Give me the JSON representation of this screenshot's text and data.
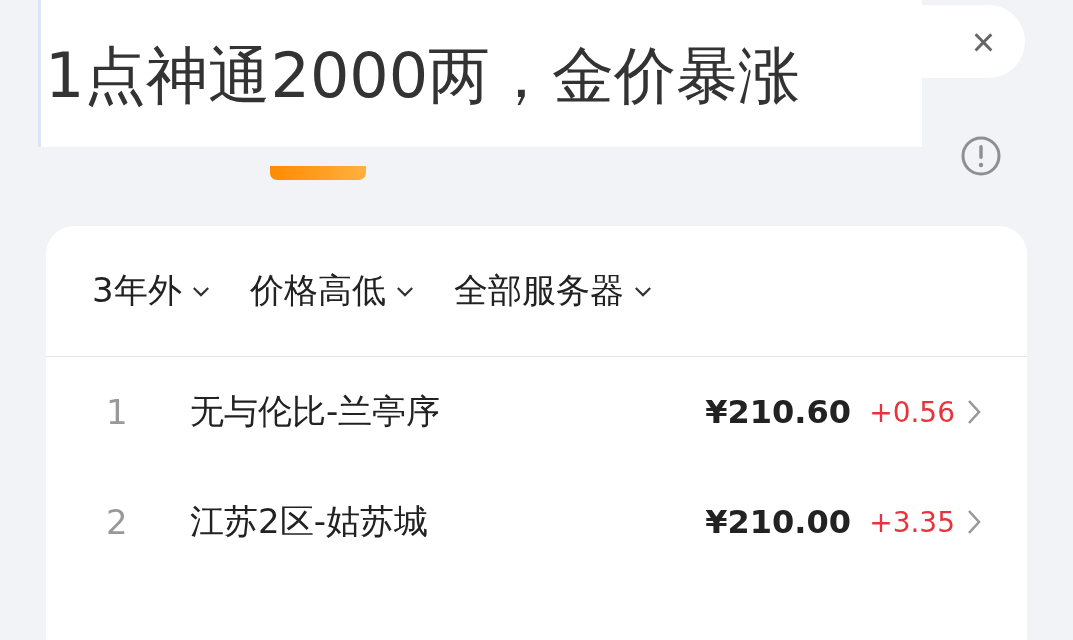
{
  "caption": "1点神通2000两，金价暴涨",
  "search": {
    "clear": "×"
  },
  "filters": [
    {
      "label": "3年外"
    },
    {
      "label": "价格高低"
    },
    {
      "label": "全部服务器"
    }
  ],
  "rows": [
    {
      "rank": "1",
      "server": "无与伦比-兰亭序",
      "price": "¥210.60",
      "change": "+0.56"
    },
    {
      "rank": "2",
      "server": "江苏2区-姑苏城",
      "price": "¥210.00",
      "change": "+3.35"
    }
  ]
}
